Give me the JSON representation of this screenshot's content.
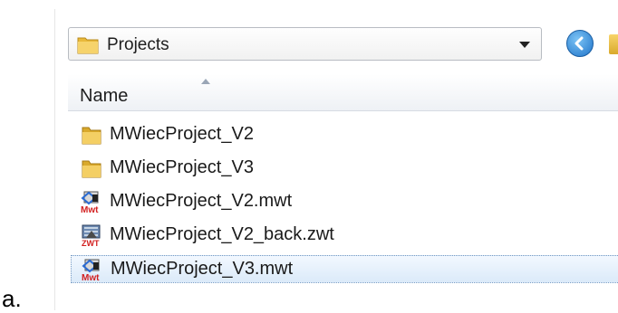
{
  "window_title": "Projects",
  "address_bar": {
    "path": "Projects"
  },
  "columns": {
    "name_header": "Name"
  },
  "files": [
    {
      "name": "MWiecProject_V2",
      "type": "folder",
      "icon": "folder-icon"
    },
    {
      "name": "MWiecProject_V3",
      "type": "folder",
      "icon": "folder-icon"
    },
    {
      "name": "MWiecProject_V2.mwt",
      "type": "mwt",
      "icon": "mwt-file-icon"
    },
    {
      "name": "MWiecProject_V2_back.zwt",
      "type": "zwt",
      "icon": "zwt-file-icon"
    },
    {
      "name": "MWiecProject_V3.mwt",
      "type": "mwt",
      "icon": "mwt-file-icon",
      "selected": true
    }
  ],
  "list_marker": "a.",
  "colors": {
    "selection": "#dbeaf9",
    "folder": "#e9b93a",
    "back_button": "#1f74c9"
  }
}
